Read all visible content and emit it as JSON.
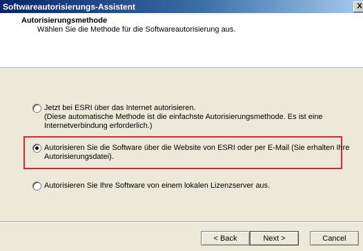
{
  "window": {
    "title": "Softwareautorisierungs-Assistent",
    "close_label": "X"
  },
  "header": {
    "title": "Autorisierungsmethode",
    "subtitle": "Wählen Sie die Methode für die Softwareautorisierung aus."
  },
  "options": [
    {
      "label": "Jetzt bei ESRI über das Internet autorisieren.\n(Diese automatische Methode ist die einfachste Autorisierungsmethode. Es ist eine Internetverbindung erforderlich.)",
      "selected": false
    },
    {
      "label": "Autorisieren Sie die Software über die Website von ESRI oder per E-Mail (Sie erhalten Ihre Autorisierungsdatei).",
      "selected": true
    },
    {
      "label": "Autorisieren Sie Ihre Software von einem lokalen Lizenzserver aus.",
      "selected": false
    }
  ],
  "buttons": {
    "back": "< Back",
    "next": "Next >",
    "cancel": "Cancel"
  },
  "colors": {
    "highlight": "#e0232f",
    "title_bar": "#0a246a"
  }
}
